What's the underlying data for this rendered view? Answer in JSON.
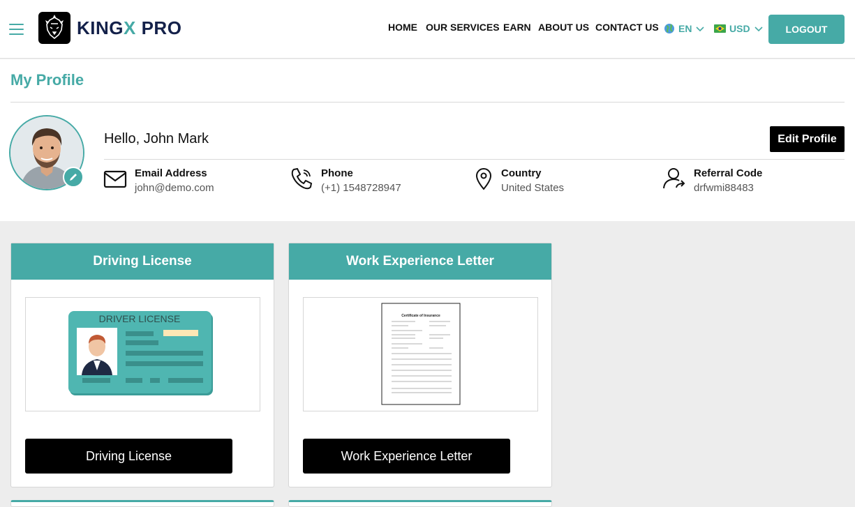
{
  "header": {
    "brand_main": "KINGX",
    "brand_accent": "X",
    "brand_rest": "PRO",
    "nav": [
      "HOME",
      "OUR SERVICES",
      "EARN",
      "ABOUT US",
      "CONTACT US"
    ],
    "language": "EN",
    "currency": "USD",
    "logout_label": "LOGOUT"
  },
  "profile": {
    "title": "My Profile",
    "greeting": "Hello, John Mark",
    "edit_label": "Edit Profile",
    "email": {
      "label": "Email Address",
      "value": "john@demo.com"
    },
    "phone": {
      "label": "Phone",
      "value": "(+1) 1548728947"
    },
    "country": {
      "label": "Country",
      "value": "United States"
    },
    "referral": {
      "label": "Referral Code",
      "value": "drfwmi88483"
    }
  },
  "documents": [
    {
      "title": "Driving License",
      "button": "Driving License",
      "image_text": "DRIVER LICENSE"
    },
    {
      "title": "Work Experience Letter",
      "button": "Work Experience Letter",
      "image_text": "Certificate of Insurance"
    }
  ],
  "colors": {
    "accent": "#46aaa6",
    "brand": "#14214a",
    "dark": "#000000"
  }
}
